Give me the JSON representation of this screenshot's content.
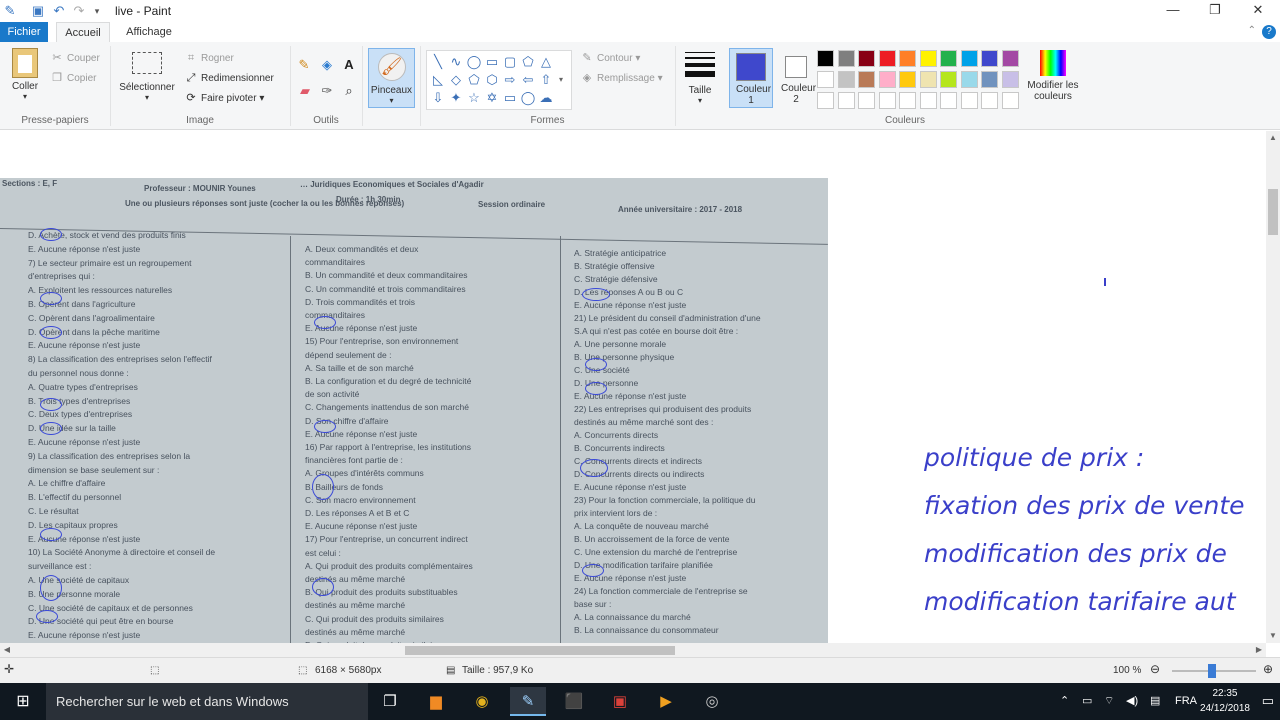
{
  "window": {
    "title": "live - Paint",
    "controls": {
      "minimize": "—",
      "restore": "❐",
      "close": "✕"
    }
  },
  "ribbon_tabs": {
    "file": "Fichier",
    "home": "Accueil",
    "view": "Affichage"
  },
  "ribbon": {
    "clipboard": {
      "paste": "Coller",
      "cut": "Couper",
      "copy": "Copier",
      "group": "Presse-papiers"
    },
    "image": {
      "select": "Sélectionner",
      "crop": "Rogner",
      "resize": "Redimensionner",
      "rotate": "Faire pivoter",
      "group": "Image"
    },
    "tools": {
      "group": "Outils"
    },
    "brushes": {
      "label": "Pinceaux"
    },
    "shapes": {
      "outline": "Contour",
      "fill": "Remplissage",
      "group": "Formes"
    },
    "size": {
      "label": "Taille"
    },
    "colors": {
      "color1_label": "Couleur 1",
      "color2_label": "Couleur 2",
      "edit_label": "Modifier les couleurs",
      "group": "Couleurs",
      "color1": "#3f48cc",
      "color2": "#ffffff",
      "palette_row1": [
        "#000000",
        "#7f7f7f",
        "#880015",
        "#ed1c24",
        "#ff7f27",
        "#fff200",
        "#22b14c",
        "#00a2e8",
        "#3f48cc",
        "#a349a4"
      ],
      "palette_row2": [
        "#ffffff",
        "#c3c3c3",
        "#b97a57",
        "#ffaec9",
        "#ffc90e",
        "#efe4b0",
        "#b5e61d",
        "#99d9ea",
        "#7092be",
        "#c8bfe7"
      ],
      "palette_row3": [
        "#ffffff",
        "#ffffff",
        "#ffffff",
        "#ffffff",
        "#ffffff",
        "#ffffff",
        "#ffffff",
        "#ffffff",
        "#ffffff",
        "#ffffff"
      ]
    }
  },
  "canvas": {
    "exam_header": {
      "section": "Sections : E, F",
      "professor": "Professeur : MOUNIR Younes",
      "school": "… Juridiques Economiques et Sociales d'Agadir",
      "duration": "Durée : 1h 30min",
      "session": "Session ordinaire",
      "year": "Année universitaire : 2017 - 2018",
      "instruction": "Une ou plusieurs réponses sont juste (cocher la ou les bonnes réponses)"
    },
    "exam_col1": [
      "D. Achète, stock et vend des produits finis",
      "E. Aucune réponse n'est juste",
      "7) Le secteur primaire est un regroupement",
      "d'entreprises qui :",
      "A. Exploitent les ressources naturelles",
      "B. Opèrent dans l'agriculture",
      "C. Opèrent dans l'agroalimentaire",
      "D. Opèrent dans la pêche maritime",
      "E. Aucune réponse n'est juste",
      "8) La classification des entreprises selon l'effectif",
      "du personnel nous donne :",
      "A. Quatre types d'entreprises",
      "B. Trois types d'entreprises",
      "C. Deux types d'entreprises",
      "D. Une idée sur la taille",
      "E. Aucune réponse n'est juste",
      "9) La classification des entreprises selon la",
      "dimension se base seulement sur :",
      "A. Le chiffre d'affaire",
      "B. L'effectif du personnel",
      "C. Le résultat",
      "D. Les capitaux propres",
      "E. Aucune réponse n'est juste",
      "10) La Société Anonyme à directoire et conseil de",
      "surveillance est :",
      "A. Une société de capitaux",
      "B. Une personne morale",
      "C. Une société de capitaux et de personnes",
      "D. Une société qui peut être en bourse",
      "E. Aucune réponse n'est juste"
    ],
    "exam_col2": [
      "A. Deux commandités et deux",
      "commanditaires",
      "B. Un commandité et deux commanditaires",
      "C. Un commandité et trois commanditaires",
      "D. Trois commandités et trois",
      "commanditaires",
      "E. Aucune réponse n'est juste",
      "15) Pour l'entreprise, son environnement",
      "dépend seulement de :",
      "A. Sa taille et de son marché",
      "B. La configuration et du degré de technicité",
      "de son activité",
      "C. Changements inattendus de son marché",
      "D. Son chiffre d'affaire",
      "E. Aucune réponse n'est juste",
      "16) Par rapport à l'entreprise, les institutions",
      "financières font partie de :",
      "A. Groupes d'intérêts communs",
      "B. Bailleurs de fonds",
      "C. Son macro environnement",
      "D. Les réponses A et B et C",
      "E. Aucune réponse n'est juste",
      "17) Pour l'entreprise, un concurrent indirect",
      "est celui :",
      "A. Qui produit des produits complémentaires",
      "destinés au même marché",
      "B. Qui produit des produits substituables",
      "destinés au même marché",
      "C. Qui produit des produits similaires",
      "destinés au même marché",
      "D. Qui produit des produits similaires ou"
    ],
    "exam_col3": [
      "A. Stratégie anticipatrice",
      "B. Stratégie offensive",
      "C. Stratégie défensive",
      "D. Les réponses A ou B ou C",
      "E. Aucune réponse n'est juste",
      "21) Le président du conseil d'administration d'une",
      "S.A qui n'est pas cotée en bourse doit être :",
      "A. Une personne morale",
      "B. Une personne physique",
      "C. Une société",
      "D. Une personne",
      "E. Aucune réponse n'est juste",
      "22) Les entreprises qui produisent des produits",
      "destinés au même marché sont des :",
      "A. Concurrents directs",
      "B. Concurrents indirects",
      "C. Concurrents directs et indirects",
      "D. Concurrents directs ou indirects",
      "E. Aucune réponse n'est juste",
      "23) Pour la fonction commerciale, la politique du",
      "prix intervient lors de :",
      "A. La conquête de nouveau marché",
      "B. Un accroissement de la force de vente",
      "C. Une extension du marché de l'entreprise",
      "D. Une modification tarifaire planifiée",
      "E. Aucune réponse n'est juste",
      "24) La fonction commerciale de l'entreprise se",
      "base sur :",
      "A. La connaissance du marché",
      "B. La connaissance du consommateur"
    ],
    "handwriting": [
      "politique de prix :",
      "fixation des prix de vente",
      "modification des prix de",
      "modification tarifaire aut"
    ]
  },
  "statusbar": {
    "dimensions": "6168 × 5680px",
    "size": "Taille : 957,9 Ko",
    "zoom": "100 %",
    "zoom_level_percent": 100
  },
  "taskbar": {
    "search_placeholder": "Rechercher sur le web et dans Windows",
    "language": "FRA",
    "time": "22:35",
    "date": "24/12/2018"
  }
}
